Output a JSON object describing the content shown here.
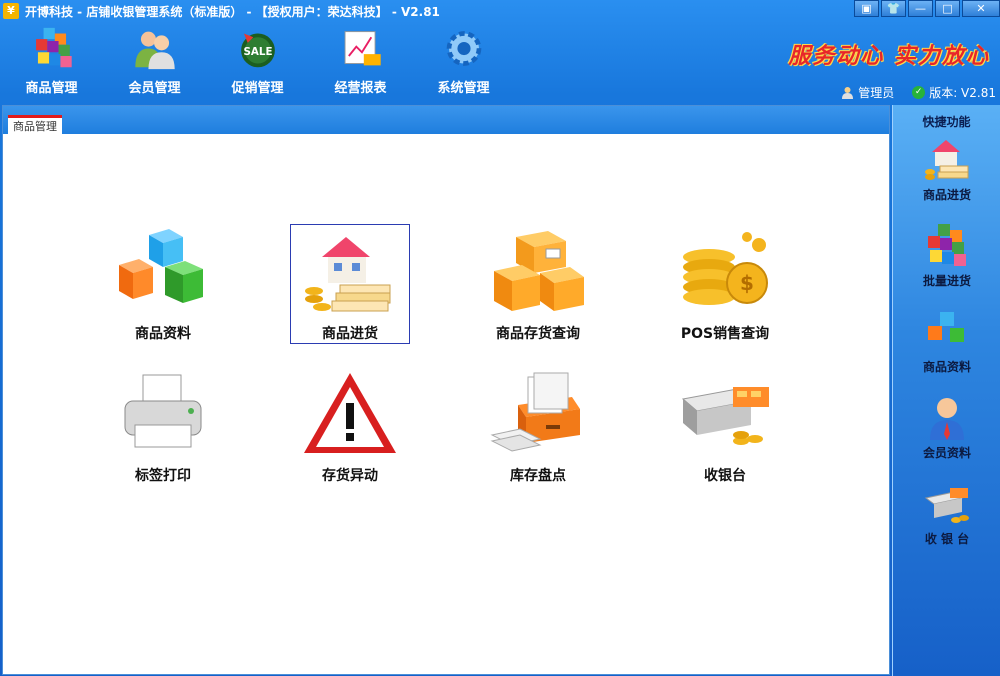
{
  "window": {
    "title": "开博科技 - 店铺收银管理系统（标准版） - 【授权用户：荣达科技】 - V2.81",
    "logo_char": "¥",
    "controls": [
      "▣",
      "👕",
      "—",
      "□",
      "✕"
    ]
  },
  "toolbar": {
    "items": [
      {
        "label": "商品管理",
        "icon": "cubes-icon"
      },
      {
        "label": "会员管理",
        "icon": "members-icon"
      },
      {
        "label": "促销管理",
        "icon": "sale-icon"
      },
      {
        "label": "经营报表",
        "icon": "report-icon"
      },
      {
        "label": "系统管理",
        "icon": "gear-icon"
      }
    ]
  },
  "slogan": "服务动心 实力放心",
  "status": {
    "user": "管理员",
    "version": "版本: V2.81"
  },
  "main": {
    "tab_label": "商品管理",
    "tiles": [
      {
        "label": "商品资料",
        "icon": "cubes-icon"
      },
      {
        "label": "商品进货",
        "icon": "house-goods-icon"
      },
      {
        "label": "商品存货查询",
        "icon": "boxes-icon"
      },
      {
        "label": "POS销售查询",
        "icon": "coins-icon"
      },
      {
        "label": "标签打印",
        "icon": "printer-icon"
      },
      {
        "label": "存货异动",
        "icon": "warning-icon"
      },
      {
        "label": "库存盘点",
        "icon": "file-drawer-icon"
      },
      {
        "label": "收银台",
        "icon": "cash-register-icon"
      }
    ]
  },
  "quick": {
    "title": "快捷功能",
    "items": [
      {
        "label": "商品进货",
        "icon": "house-goods-icon"
      },
      {
        "label": "批量进货",
        "icon": "batch-cubes-icon"
      },
      {
        "label": "商品资料",
        "icon": "cubes-icon"
      },
      {
        "label": "会员资料",
        "icon": "member-icon"
      },
      {
        "label": "收 银 台",
        "icon": "cash-register-icon"
      }
    ]
  }
}
